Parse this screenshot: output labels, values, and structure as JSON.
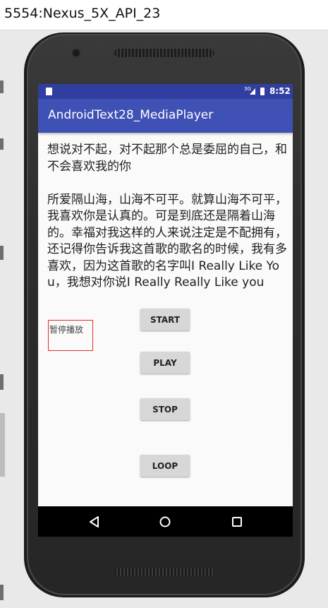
{
  "window": {
    "title": "5554:Nexus_5X_API_23"
  },
  "status_bar": {
    "time": "8:52",
    "network": "3G",
    "color": "#303f9f"
  },
  "app_bar": {
    "title": "AndroidText28_MediaPlayer",
    "color": "#3f51b5"
  },
  "content": {
    "lyrics": "想说对不起，对不起那个总是委屈的自己，和不会喜欢我的你\n\n所爱隔山海，山海不可平。就算山海不可平，我喜欢你是认真的。可是到底还是隔着山海的。幸福对我这样的人来说注定是不配拥有，还记得你告诉我这首歌的歌名的时候，我有多喜欢，因为这首歌的名字叫I Really Like You，我想对你说I Really Really Like you",
    "status_label": "暂停播放"
  },
  "buttons": {
    "start": "START",
    "play": "PLAY",
    "stop": "STOP",
    "loop": "LOOP"
  },
  "nav": {
    "back_icon": "back-triangle-icon",
    "home_icon": "home-circle-icon",
    "recent_icon": "recents-square-icon"
  }
}
